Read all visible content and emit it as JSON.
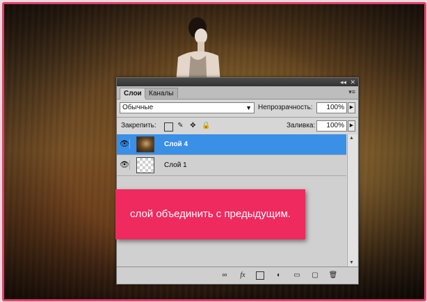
{
  "colors": {
    "frame": "#e0416b",
    "selected_layer": "#3a8fe6",
    "caption_bg": "#ef2a5f"
  },
  "panel": {
    "title_controls": {
      "collapse": "◂◂",
      "close": "✕"
    },
    "tabs": [
      {
        "label": "Слои",
        "active": true
      },
      {
        "label": "Каналы",
        "active": false
      }
    ],
    "menu_icon": "panel-menu-icon",
    "blend_mode": "Обычные",
    "opacity_label": "Непрозрачность:",
    "opacity_value": "100%",
    "lock_label": "Закрепить:",
    "fill_label": "Заливка:",
    "fill_value": "100%",
    "layers": [
      {
        "name": "Слой 4",
        "selected": true,
        "visible": true,
        "thumb": "photo"
      },
      {
        "name": "Слой 1",
        "selected": false,
        "visible": true,
        "thumb": "transparent"
      }
    ],
    "bottom_icons": [
      "link-icon",
      "fx-icon",
      "mask-icon",
      "adjustment-icon",
      "folder-icon",
      "new-layer-icon",
      "trash-icon"
    ]
  },
  "caption": {
    "text": "слой объединить с предыдущим."
  }
}
